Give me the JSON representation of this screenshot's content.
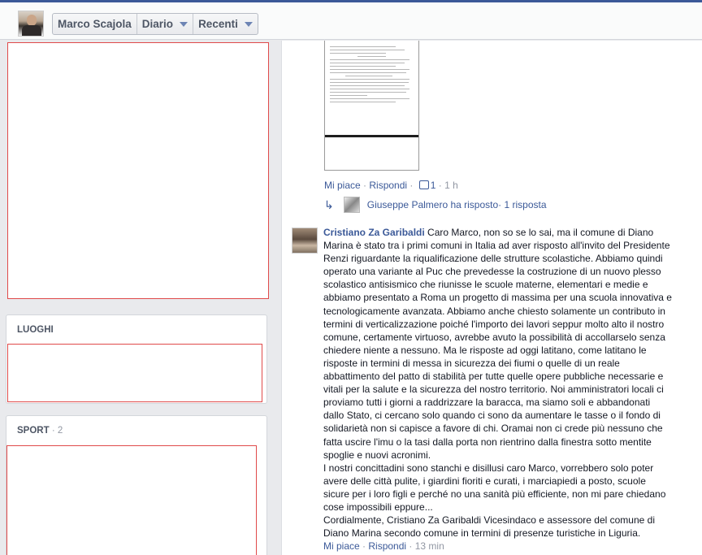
{
  "header": {
    "name": "Marco Scajola",
    "diario": "Diario",
    "recenti": "Recenti"
  },
  "sidebar": {
    "luoghi_title": "LUOGHI",
    "sport_title": "SPORT",
    "sport_count": " · 2"
  },
  "post": {
    "like": "Mi piace",
    "sep1": " · ",
    "reply": "Rispondi",
    "sep2": " · ",
    "like_count": "1",
    "time": " · 1 h",
    "reply_author_text": "Giuseppe Palmero ha risposto",
    "reply_count": " · 1 risposta"
  },
  "comment": {
    "author": "Cristiano Za Garibaldi",
    "paragraph1": "Caro Marco, non so se lo sai, ma il comune di Diano Marina è stato tra i primi comuni in Italia ad aver risposto all'invito del Presidente Renzi riguardante la riqualificazione delle strutture scolastiche. Abbiamo quindi operato una variante al Puc che prevedesse la costruzione di un nuovo plesso scolastico antisismico che riunisse le scuole materne, elementari e medie e abbiamo presentato a Roma un progetto di massima per una scuola innovativa e tecnologicamente avanzata. Abbiamo anche chiesto solamente un contributo in termini di verticalizzazione poiché l'importo dei lavori seppur molto alto il nostro comune, certamente virtuoso, avrebbe avuto la possibilità di accollarselo senza chiedere niente a nessuno. Ma le risposte ad oggi latitano, come latitano le risposte in termini di messa in sicurezza dei fiumi o quelle di un reale abbattimento del patto di stabilità per tutte quelle opere pubbliche necessarie e vitali per la salute e la sicurezza del nostro territorio. Noi amministratori locali ci proviamo tutti i giorni a raddrizzare la baracca, ma siamo soli e abbandonati dallo Stato, ci cercano solo quando ci sono da aumentare le tasse o il fondo di solidarietà non si capisce a favore di chi. Oramai non ci crede più nessuno che fatta uscire l'imu o la tasi dalla porta non rientrino dalla finestra sotto mentite spoglie e nuovi acronimi.",
    "paragraph2": "I nostri concittadini sono stanchi e disillusi caro Marco, vorrebbero solo poter avere delle città pulite, i giardini fioriti e curati, i marciapiedi a posto, scuole sicure per i loro figli e perché no una sanità più efficiente, non mi pare chiedano cose impossibili eppure...",
    "paragraph3": "Cordialmente, Cristiano Za Garibaldi Vicesindaco e assessore del comune di Diano Marina secondo comune in termini di presenze turistiche in Liguria.",
    "like": "Mi piace",
    "sep1": " · ",
    "reply": "Rispondi",
    "time": " · 13 min"
  },
  "colors": {
    "link": "#3b5998",
    "highlight_box": "#e04a4a",
    "muted": "#9197a3"
  }
}
